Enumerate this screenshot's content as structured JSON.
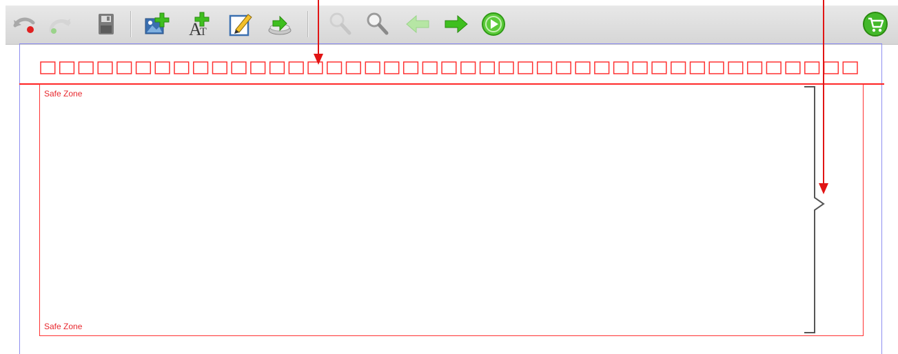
{
  "toolbar": {
    "buttons": [
      {
        "id": "undo",
        "icon": "undo-icon"
      },
      {
        "id": "redo",
        "icon": "redo-icon"
      },
      {
        "id": "save",
        "icon": "save-icon"
      },
      {
        "id": "add-image",
        "icon": "add-image-icon"
      },
      {
        "id": "add-text",
        "icon": "add-text-icon"
      },
      {
        "id": "edit",
        "icon": "pencil-icon"
      },
      {
        "id": "import",
        "icon": "import-icon"
      },
      {
        "id": "zoom-out",
        "icon": "zoom-out-icon"
      },
      {
        "id": "zoom-in",
        "icon": "zoom-in-icon"
      },
      {
        "id": "previous",
        "icon": "arrow-left-icon"
      },
      {
        "id": "next",
        "icon": "arrow-right-icon"
      },
      {
        "id": "play",
        "icon": "play-icon"
      },
      {
        "id": "cart",
        "icon": "shopping-cart-icon"
      }
    ]
  },
  "canvas": {
    "safe_zone_top_label": "Safe Zone",
    "safe_zone_bottom_label": "Safe Zone",
    "binding_hole_count": 43
  },
  "colors": {
    "safe_zone": "#ff3030",
    "canvas_border": "#8d8df0",
    "toolbar_bg": "#dcdcdc",
    "icon_green": "#3fbf1f",
    "icon_blue": "#3a6fb0"
  }
}
